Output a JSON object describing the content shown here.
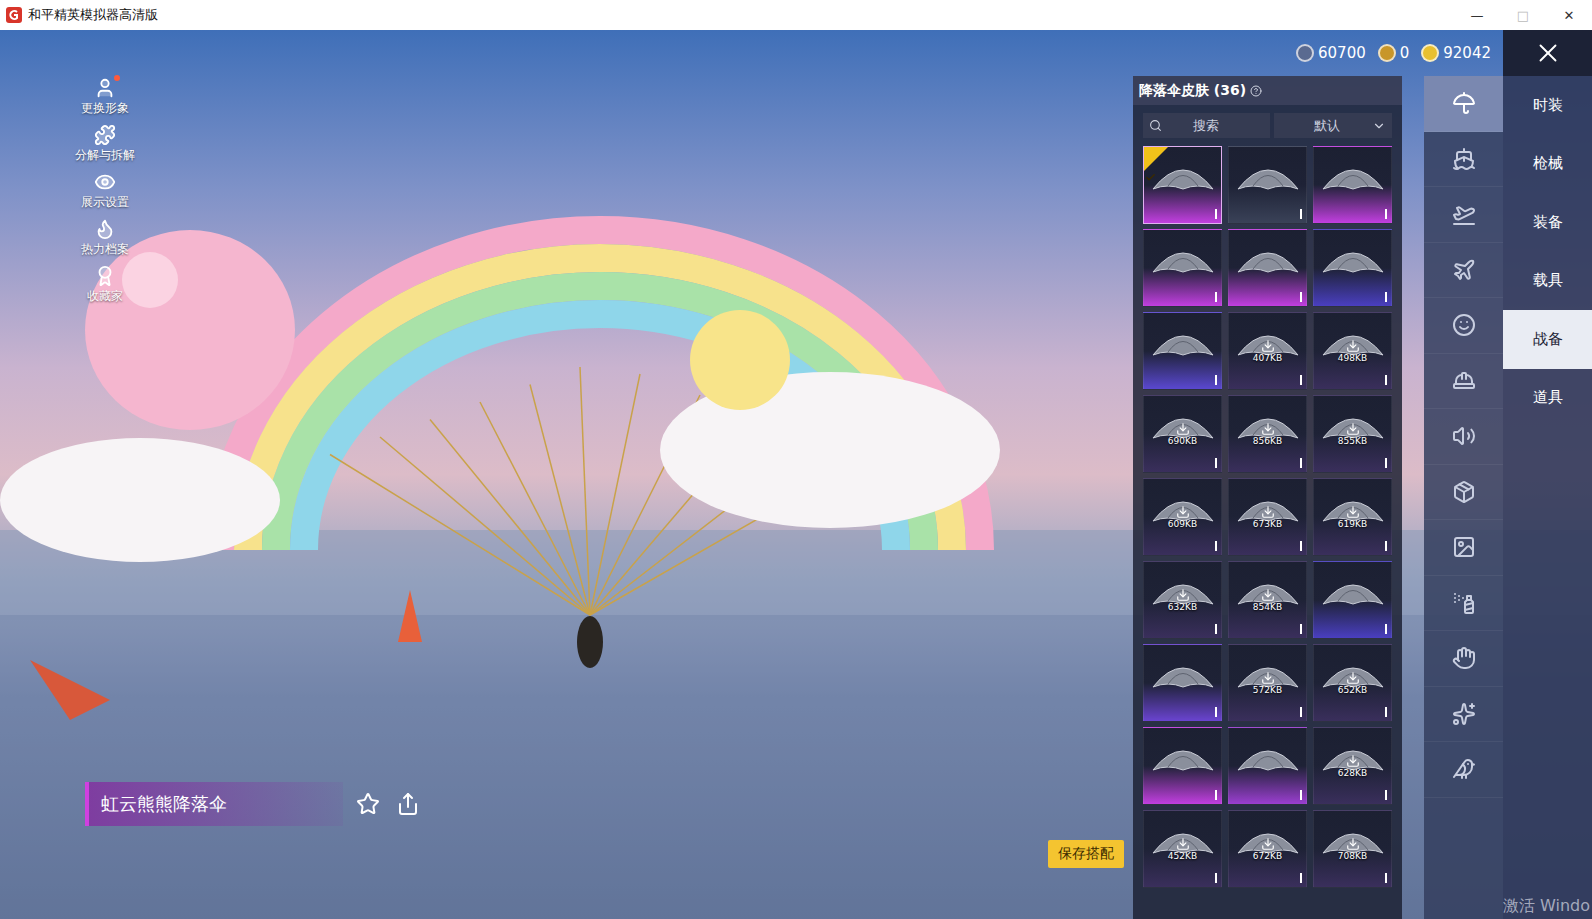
{
  "window": {
    "title": "和平精英模拟器高清版",
    "controls": [
      "—",
      "□",
      "✕"
    ]
  },
  "side_menu": [
    {
      "label": "更换形象",
      "badge": true
    },
    {
      "label": "分解与拆解",
      "badge": false
    },
    {
      "label": "展示设置",
      "badge": false
    },
    {
      "label": "热力档案",
      "badge": false
    },
    {
      "label": "收藏家",
      "badge": false
    }
  ],
  "currencies": [
    {
      "value": "60700",
      "color": "#5a6a90"
    },
    {
      "value": "0",
      "color": "#c8962a"
    },
    {
      "value": "92042",
      "color": "#e8c030"
    }
  ],
  "panel": {
    "title": "降落伞皮肤 (36)",
    "search": {
      "placeholder": "搜索"
    },
    "sort": {
      "value": "默认"
    },
    "items": [
      {
        "color": "#c23fe0",
        "selected": true
      },
      {
        "color": "#3a4258",
        "selected": false
      },
      {
        "color": "#c23fe0",
        "selected": false
      },
      {
        "color": "#c23fe0",
        "selected": false
      },
      {
        "color": "#c23fe0",
        "selected": false
      },
      {
        "color": "#4a3fc0",
        "selected": false
      },
      {
        "color": "#5a48d0",
        "selected": false
      },
      {
        "color": "#3a2f5c",
        "selected": false,
        "size": "407KB"
      },
      {
        "color": "#3a2f5c",
        "selected": false,
        "size": "498KB"
      },
      {
        "color": "#3a2f5c",
        "selected": false,
        "size": "690KB"
      },
      {
        "color": "#3a2f5c",
        "selected": false,
        "size": "856KB"
      },
      {
        "color": "#3a2f5c",
        "selected": false,
        "size": "855KB"
      },
      {
        "color": "#3a2f5c",
        "selected": false,
        "size": "609KB"
      },
      {
        "color": "#3a2f5c",
        "selected": false,
        "size": "673KB"
      },
      {
        "color": "#3a2f5c",
        "selected": false,
        "size": "619KB"
      },
      {
        "color": "#3a2f5c",
        "selected": false,
        "size": "632KB"
      },
      {
        "color": "#3a2f5c",
        "selected": false,
        "size": "854KB"
      },
      {
        "color": "#4a3fc0",
        "selected": false
      },
      {
        "color": "#6a44d0",
        "selected": false
      },
      {
        "color": "#3a2f5c",
        "selected": false,
        "size": "572KB"
      },
      {
        "color": "#3a2f5c",
        "selected": false,
        "size": "652KB"
      },
      {
        "color": "#c23fe0",
        "selected": false
      },
      {
        "color": "#9b3fd0",
        "selected": false
      },
      {
        "color": "#3a2f5c",
        "selected": false,
        "size": "628KB"
      },
      {
        "color": "#3a2f5c",
        "selected": false,
        "size": "452KB"
      },
      {
        "color": "#3a2f5c",
        "selected": false,
        "size": "672KB"
      },
      {
        "color": "#3a2f5c",
        "selected": false,
        "size": "708KB"
      }
    ]
  },
  "categories": [
    {
      "selected": true
    },
    {
      "selected": false
    },
    {
      "selected": false
    },
    {
      "selected": false
    },
    {
      "selected": false
    },
    {
      "selected": false
    },
    {
      "selected": false
    },
    {
      "selected": false
    },
    {
      "selected": false
    },
    {
      "selected": false
    },
    {
      "selected": false
    },
    {
      "selected": false
    },
    {
      "selected": false
    }
  ],
  "tabs": [
    {
      "label": "时装",
      "selected": false
    },
    {
      "label": "枪械",
      "selected": false
    },
    {
      "label": "装备",
      "selected": false
    },
    {
      "label": "载具",
      "selected": false
    },
    {
      "label": "战备",
      "selected": true
    },
    {
      "label": "道具",
      "selected": false
    }
  ],
  "item_name": "虹云熊熊降落伞",
  "save_button": "保存搭配",
  "watermark": "激活 Windo"
}
